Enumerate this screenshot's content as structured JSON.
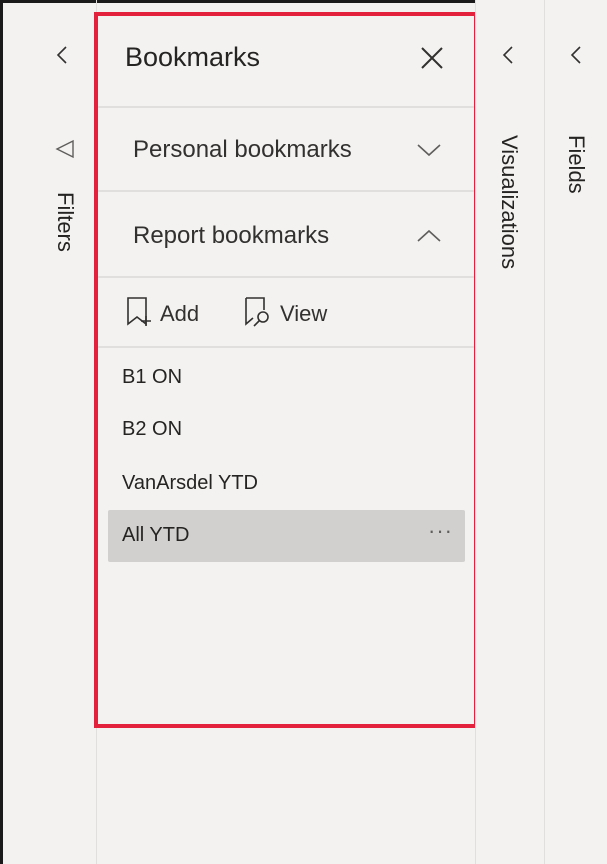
{
  "filters_pane": {
    "label": "Filters"
  },
  "bookmarks_pane": {
    "title": "Bookmarks",
    "sections": [
      {
        "label": "Personal bookmarks",
        "state": "collapsed"
      },
      {
        "label": "Report bookmarks",
        "state": "expanded"
      }
    ],
    "actions": {
      "add_label": "Add",
      "view_label": "View"
    },
    "items": [
      {
        "label": "B1 ON",
        "selected": false
      },
      {
        "label": "B2 ON",
        "selected": false
      },
      {
        "label": "VanArsdel YTD",
        "selected": false
      },
      {
        "label": "All YTD",
        "selected": true,
        "more": "···"
      }
    ]
  },
  "visualizations_pane": {
    "label": "Visualizations"
  },
  "fields_pane": {
    "label": "Fields"
  },
  "colors": {
    "highlight_border": "#e3213d",
    "pane_bg": "#f3f2f1",
    "selected_bg": "#d2d0ce"
  },
  "icons": {
    "collapse": "chevron-left-icon",
    "filter": "filter-icon",
    "close": "close-icon",
    "expand": "chevron-down-icon",
    "collapse_section": "chevron-up-icon",
    "add_bookmark": "bookmark-add-icon",
    "view_bookmark": "bookmark-view-icon"
  }
}
